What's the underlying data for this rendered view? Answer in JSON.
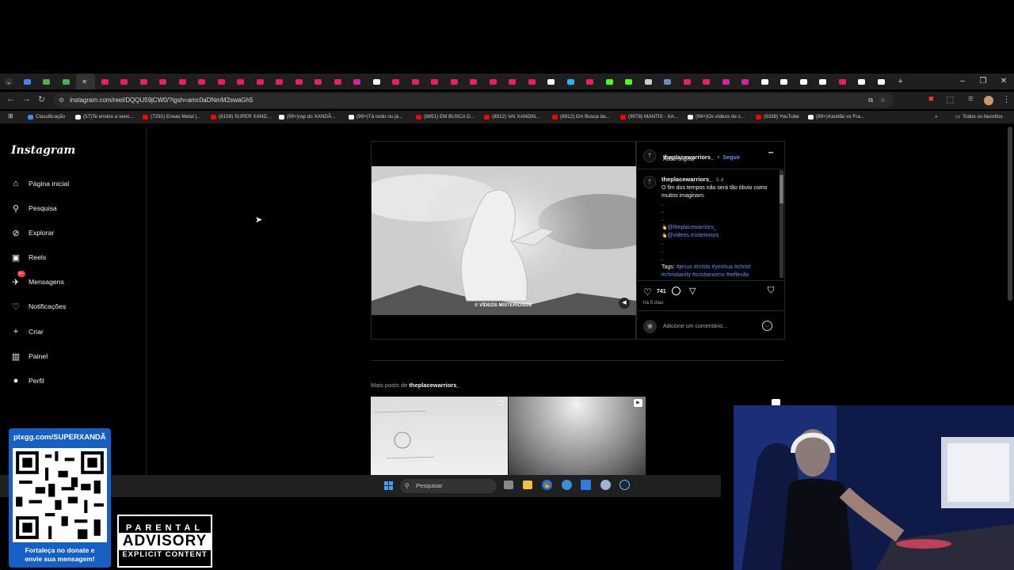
{
  "browser": {
    "url": "instagram.com/reel/DQQU59jCW0/?igsh=amc0aDNmM2swaGh5",
    "tab_favicons": [
      "#4285f4",
      "#4caf50",
      "#4caf50",
      "#aaa",
      "#e91e63",
      "#e91e63",
      "#e91e63",
      "#e91e63",
      "#e91e63",
      "#e91e63",
      "#e91e63",
      "#e91e63",
      "#e91e63",
      "#e91e63",
      "#e91e63",
      "#e91e63",
      "#e91e63",
      "#d6249f",
      "#fff",
      "#e91e63",
      "#e91e63",
      "#e91e63",
      "#e91e63",
      "#e91e63",
      "#e91e63",
      "#e91e63",
      "#e91e63",
      "#fff",
      "#29b6f6",
      "#e91e63",
      "#53fc18",
      "#53fc18",
      "#ccc",
      "#7986cb",
      "#e91e63",
      "#e91e63",
      "#d6249f",
      "#d6249f",
      "#fff",
      "#fff",
      "#fff",
      "#fff",
      "#e91e63",
      "#fff",
      "#fff"
    ],
    "window_controls": [
      "–",
      "❐",
      "✕"
    ],
    "bookmarks": [
      {
        "label": "Classificação",
        "color": "#4285f4"
      },
      {
        "label": "(57)Te ensino a venc...",
        "color": "#fff"
      },
      {
        "label": "(7292) Eneas Metal |...",
        "color": "#ff0000"
      },
      {
        "label": "(8159) SUPER XAND...",
        "color": "#ff0000"
      },
      {
        "label": "(99+)rap do XANDÃ...",
        "color": "#fff"
      },
      {
        "label": "(99+)Tá cedo ou já...",
        "color": "#fff"
      },
      {
        "label": "(8851) EM BUSCA D...",
        "color": "#ff0000"
      },
      {
        "label": "(8912) VAI XANDIN...",
        "color": "#ff0000"
      },
      {
        "label": "(8912) Em Busca da...",
        "color": "#ff0000"
      },
      {
        "label": "(9078) MANTIS - XA...",
        "color": "#ff0000"
      },
      {
        "label": "(99+)Os vídeos de c...",
        "color": "#fff"
      },
      {
        "label": "(9338) YouTube",
        "color": "#ff0000"
      },
      {
        "label": "(99+)Xandão vs Fra...",
        "color": "#fff"
      }
    ],
    "all_bookmarks": "Todos os favoritos"
  },
  "instagram": {
    "logo": "Instagram",
    "nav": [
      {
        "label": "Página inicial",
        "icon": "home-icon",
        "glyph": "⌂"
      },
      {
        "label": "Pesquisa",
        "icon": "search-icon",
        "glyph": "⚲"
      },
      {
        "label": "Explorar",
        "icon": "compass-icon",
        "glyph": "⊘"
      },
      {
        "label": "Reels",
        "icon": "reels-icon",
        "glyph": "▣"
      },
      {
        "label": "Mensagens",
        "icon": "messenger-icon",
        "glyph": "✈"
      },
      {
        "label": "Notificações",
        "icon": "heart-icon",
        "glyph": "♡"
      },
      {
        "label": "Criar",
        "icon": "plus-icon",
        "glyph": "+"
      },
      {
        "label": "Painel",
        "icon": "chart-icon",
        "glyph": "▥"
      },
      {
        "label": "Perfil",
        "icon": "avatar-icon",
        "glyph": "●"
      }
    ],
    "messages_badge": "9+",
    "post": {
      "username": "theplacewarriors_",
      "follow": "Seguir",
      "separator": "•",
      "audio": "Áudio original",
      "more": "•••",
      "video_watermark": "© VÍDEOS MISTERIOSOS",
      "caption_user": "theplacewarriors_",
      "caption_age": "5 d",
      "caption_text": "O fim dos tempos não será tão óbvio como muitos imaginam.",
      "dots": [
        ".",
        ".",
        "."
      ],
      "mentions": [
        "@theplacewarriors_",
        "@videos.misteriosos"
      ],
      "dots2": [
        ".",
        ".",
        "."
      ],
      "tags_label": "Tags:",
      "tags": "#jesus #cristo #yeshua #christ #christianity #cristianismo #reflexão",
      "likes": "741",
      "age": "há 5 dias",
      "comment_placeholder": "Adicione um comentário..."
    },
    "more_posts_prefix": "Mais posts de",
    "more_posts_user": "theplacewarriors_"
  },
  "taskbar": {
    "search_placeholder": "Pesquisar"
  },
  "overlay": {
    "qr_url": "pixgg.com/SUPERXANDÃ",
    "donate_line1": "Fortaleça no donate e",
    "donate_line2": "envie sua mensagem!",
    "advisory_top": "PARENTAL",
    "advisory_mid": "ADVISORY",
    "advisory_bottom": "EXPLICIT CONTENT"
  }
}
